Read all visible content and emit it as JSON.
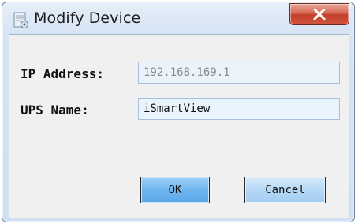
{
  "window": {
    "title": "Modify Device",
    "close_icon": "close-icon",
    "app_icon": "device-settings-icon"
  },
  "form": {
    "ip_label": "IP Address:",
    "ip_value": "192.168.169.1",
    "ups_label": "UPS Name:",
    "ups_value": "iSmartView"
  },
  "buttons": {
    "ok_label": "OK",
    "cancel_label": "Cancel"
  },
  "colors": {
    "close_button": "#c94a33",
    "ok_button": "#6fb6ef",
    "cancel_button": "#b5d8f5"
  }
}
